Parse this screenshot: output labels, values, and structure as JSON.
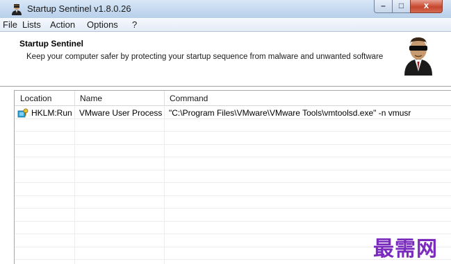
{
  "window": {
    "title": "Startup Sentinel v1.8.0.26",
    "controls": {
      "minimize": "–",
      "maximize": "□",
      "close": "x"
    }
  },
  "menu": [
    "File",
    "Lists",
    "Action",
    "Options",
    "?"
  ],
  "header": {
    "title": "Startup Sentinel",
    "description": "Keep your computer safer by protecting your startup sequence from malware and unwanted software"
  },
  "list": {
    "columns": [
      "Location",
      "Name",
      "Command"
    ],
    "rows": [
      {
        "icon": "registry-key-icon",
        "location": "HKLM:Run",
        "name": "VMware User Process",
        "command": "\"C:\\Program Files\\VMware\\VMware Tools\\vmtoolsd.exe\" -n vmusr"
      }
    ]
  },
  "watermark": "最需网",
  "colors": {
    "titlebar": "#c3d8ef",
    "close_button": "#c7462e",
    "watermark": "#7a2bbd"
  }
}
